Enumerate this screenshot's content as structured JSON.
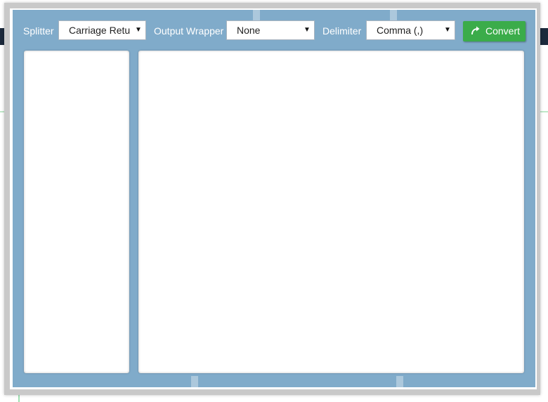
{
  "toolbar": {
    "splitter_label": "Splitter",
    "splitter_value": "Carriage Retu",
    "wrapper_label": "Output Wrapper",
    "wrapper_value": "None",
    "delimiter_label": "Delimiter",
    "delimiter_value": "Comma (,)",
    "convert_label": "Convert"
  },
  "colors": {
    "panel": "#80abca",
    "button": "#3bac4a",
    "text_on_panel": "#ffffff"
  },
  "icons": {
    "convert": "redo-arrow-icon",
    "dropdown": "caret-down-icon"
  }
}
